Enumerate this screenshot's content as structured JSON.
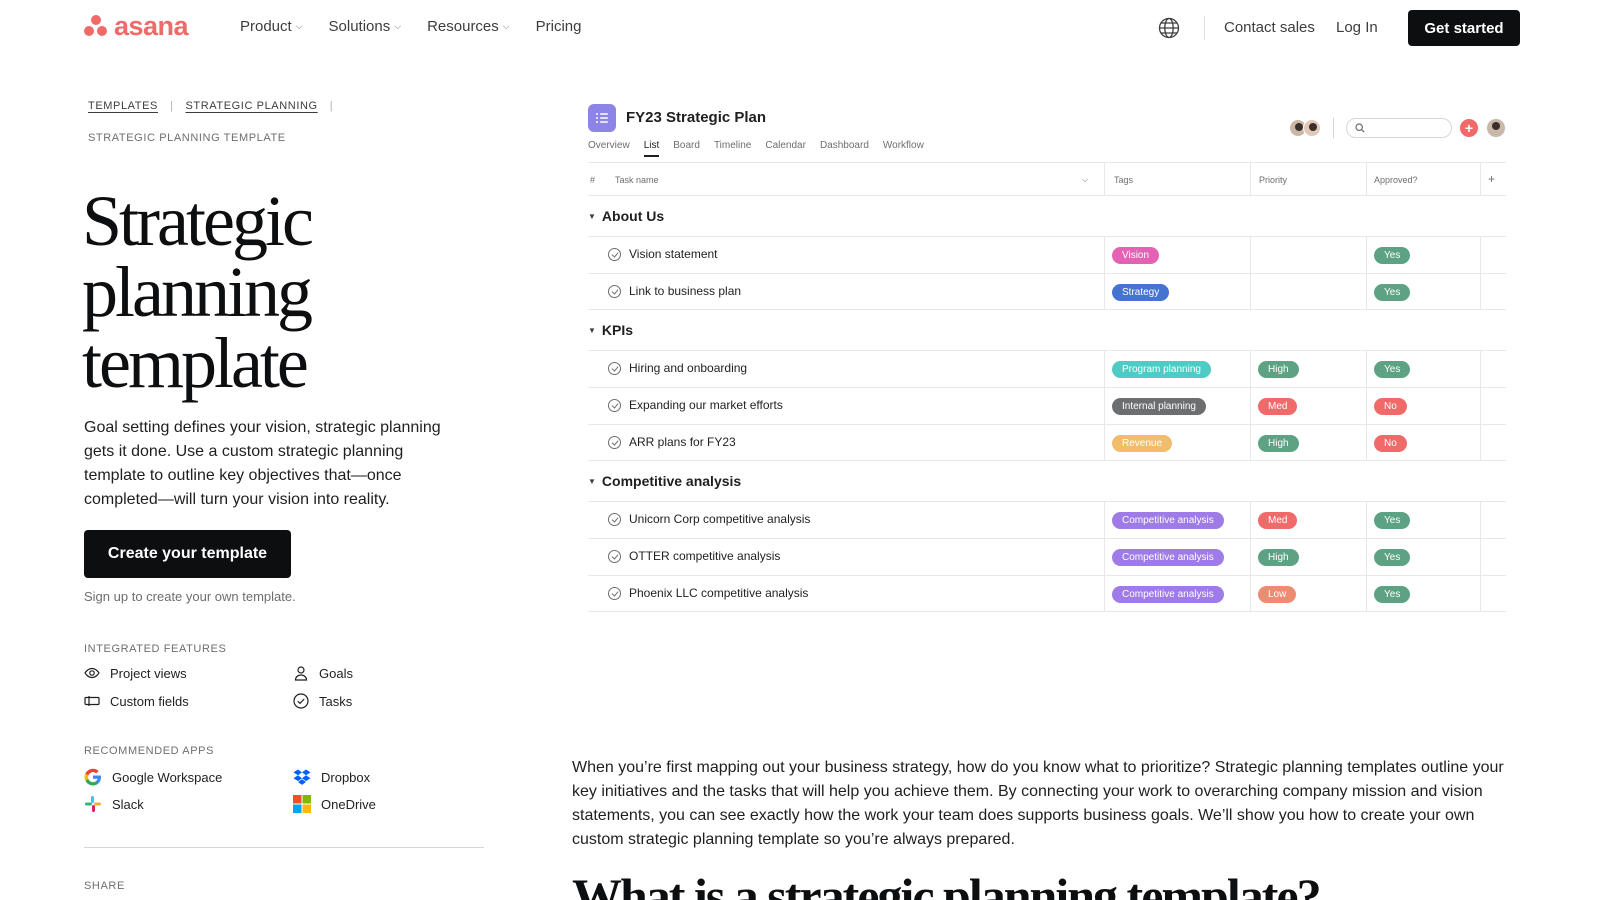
{
  "nav": {
    "logo_text": "asana",
    "links": [
      {
        "label": "Product",
        "dropdown": true
      },
      {
        "label": "Solutions",
        "dropdown": true
      },
      {
        "label": "Resources",
        "dropdown": true
      },
      {
        "label": "Pricing",
        "dropdown": false
      }
    ],
    "contact": "Contact sales",
    "login": "Log In",
    "cta": "Get started"
  },
  "breadcrumb": {
    "items": [
      "TEMPLATES",
      "STRATEGIC PLANNING"
    ],
    "current": "STRATEGIC PLANNING TEMPLATE"
  },
  "hero": {
    "title_lines": [
      "Strategic",
      "planning",
      "template"
    ],
    "description": "Goal setting defines your vision, strategic planning gets it done. Use a custom strategic planning template to outline key objectives that—once completed—will turn your vision into reality.",
    "cta": "Create your template",
    "note": "Sign up to create your own template."
  },
  "features": {
    "label": "INTEGRATED FEATURES",
    "items": [
      {
        "label": "Project views",
        "icon": "eye-icon"
      },
      {
        "label": "Goals",
        "icon": "person-icon"
      },
      {
        "label": "Custom fields",
        "icon": "custom-fields-icon"
      },
      {
        "label": "Tasks",
        "icon": "check-circle-icon"
      }
    ]
  },
  "apps": {
    "label": "RECOMMENDED APPS",
    "items": [
      {
        "label": "Google Workspace",
        "icon": "google-icon"
      },
      {
        "label": "Dropbox",
        "icon": "dropbox-icon"
      },
      {
        "label": "Slack",
        "icon": "slack-icon"
      },
      {
        "label": "OneDrive",
        "icon": "onedrive-icon"
      }
    ]
  },
  "share": {
    "label": "SHARE"
  },
  "mock": {
    "title": "FY23 Strategic Plan",
    "tabs": [
      "Overview",
      "List",
      "Board",
      "Timeline",
      "Calendar",
      "Dashboard",
      "Workflow"
    ],
    "active_tab": "List",
    "columns": [
      "#",
      "Task name",
      "Tags",
      "Priority",
      "Approved?"
    ],
    "add_column": "+",
    "sections": [
      {
        "name": "About Us",
        "tasks": [
          {
            "name": "Vision statement",
            "tag": "Vision",
            "tag_color": "#e362b4",
            "priority": "",
            "priority_color": "",
            "approved": "Yes",
            "approved_color": "#5da283"
          },
          {
            "name": "Link to business plan",
            "tag": "Strategy",
            "tag_color": "#4573d2",
            "priority": "",
            "priority_color": "",
            "approved": "Yes",
            "approved_color": "#5da283"
          }
        ]
      },
      {
        "name": "KPIs",
        "tasks": [
          {
            "name": "Hiring and onboarding",
            "tag": "Program planning",
            "tag_color": "#4ecbc4",
            "priority": "High",
            "priority_color": "#5da283",
            "approved": "Yes",
            "approved_color": "#5da283"
          },
          {
            "name": "Expanding our market efforts",
            "tag": "Internal planning",
            "tag_color": "#6d6e6f",
            "priority": "Med",
            "priority_color": "#f06a6a",
            "approved": "No",
            "approved_color": "#f06a6a"
          },
          {
            "name": "ARR plans for FY23",
            "tag": "Revenue",
            "tag_color": "#f1bd6c",
            "priority": "High",
            "priority_color": "#5da283",
            "approved": "No",
            "approved_color": "#f06a6a"
          }
        ]
      },
      {
        "name": "Competitive analysis",
        "tasks": [
          {
            "name": "Unicorn Corp competitive analysis",
            "tag": "Competitive analysis",
            "tag_color": "#9e7be6",
            "priority": "Med",
            "priority_color": "#f06a6a",
            "approved": "Yes",
            "approved_color": "#5da283"
          },
          {
            "name": "OTTER competitive analysis",
            "tag": "Competitive analysis",
            "tag_color": "#9e7be6",
            "priority": "High",
            "priority_color": "#5da283",
            "approved": "Yes",
            "approved_color": "#5da283"
          },
          {
            "name": "Phoenix LLC competitive analysis",
            "tag": "Competitive analysis",
            "tag_color": "#9e7be6",
            "priority": "Low",
            "priority_color": "#ec8d71",
            "approved": "Yes",
            "approved_color": "#5da283"
          }
        ]
      }
    ]
  },
  "article": {
    "intro": "When you’re first mapping out your business strategy, how do you know what to prioritize? Strategic planning templates outline your key initiatives and the tasks that will help you achieve them. By connecting your work to overarching company mission and vision statements, you can see exactly how the work your team does supports business goals. We’ll show you how to create your own custom strategic planning template so you’re always prepared.",
    "heading": "What is a strategic planning template?"
  },
  "colors": {
    "brand": "#f06a6a",
    "dark": "#0d0e10",
    "project_icon": "#8d84e8"
  }
}
